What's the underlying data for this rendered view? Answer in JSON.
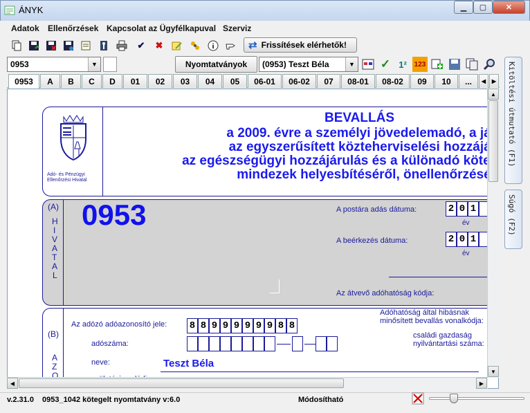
{
  "window": {
    "title": "ÁNYK"
  },
  "menu": [
    "Adatok",
    "Ellenőrzések",
    "Kapcsolat az Ügyfélkapuval",
    "Szerviz"
  ],
  "toolbar": {
    "update_label": "Frissítések elérhetők!"
  },
  "selector": {
    "form_code": "0953",
    "forms_button": "Nyomtatványok",
    "person": "(0953) Teszt Béla"
  },
  "tabs": [
    "0953",
    "A",
    "B",
    "C",
    "D",
    "01",
    "02",
    "03",
    "04",
    "05",
    "06-01",
    "06-02",
    "07",
    "08-01",
    "08-02",
    "09",
    "10",
    "..."
  ],
  "side_panel": {
    "fill_guide": "Kitöltési útmutató (F1)",
    "help": "Súgó (F2)"
  },
  "header": {
    "logo_caption_1": "Adó- és Pénzügyi",
    "logo_caption_2": "Ellenőrzési Hivatal",
    "title": "BEVALLÁS",
    "line1": "a 2009. évre a személyi jövedelemadó, a járul",
    "line2": "az egyszerűsített közteherviselési hozzájárul",
    "line3": "az egészségügyi hozzájárulás és a különadó kötelez",
    "line4": "mindezek helyesbítéséről, önellenőrzéséről"
  },
  "section_a": {
    "marker": "(A)",
    "vertical": [
      "H",
      "I",
      "V",
      "A",
      "T",
      "A",
      "L"
    ],
    "form_code": "0953",
    "postal_label": "A postára adás dátuma:",
    "arrival_label": "A beérkezés dátuma:",
    "year_digits": [
      "2",
      "0",
      "1"
    ],
    "year_label": "év",
    "authority_label": "Az átvevő adóhatóság kódja:"
  },
  "section_b": {
    "marker": "(B)",
    "vertical": [
      "A",
      "Z",
      "O"
    ],
    "taxid_label": "Az adózó adóazonosító jele:",
    "taxid_digits": [
      "8",
      "8",
      "9",
      "9",
      "9",
      "9",
      "9",
      "9",
      "8",
      "8"
    ],
    "taxnum_label": "adószáma:",
    "name_label": "neve:",
    "name_value": "Teszt Béla",
    "birth_label": "születési családi",
    "barcode_label_1": "Adóhatóság által hibásnak",
    "barcode_label_2": "minősített bevallás vonalkódja:",
    "farm_label_1": "családi gazdaság",
    "farm_label_2": "nyilvántartási száma:"
  },
  "status": {
    "version": "v.2.31.0",
    "info": "0953_1042 kötegelt nyomtatvány v:6.0",
    "mode": "Módosítható",
    "zoom": 0.24
  }
}
